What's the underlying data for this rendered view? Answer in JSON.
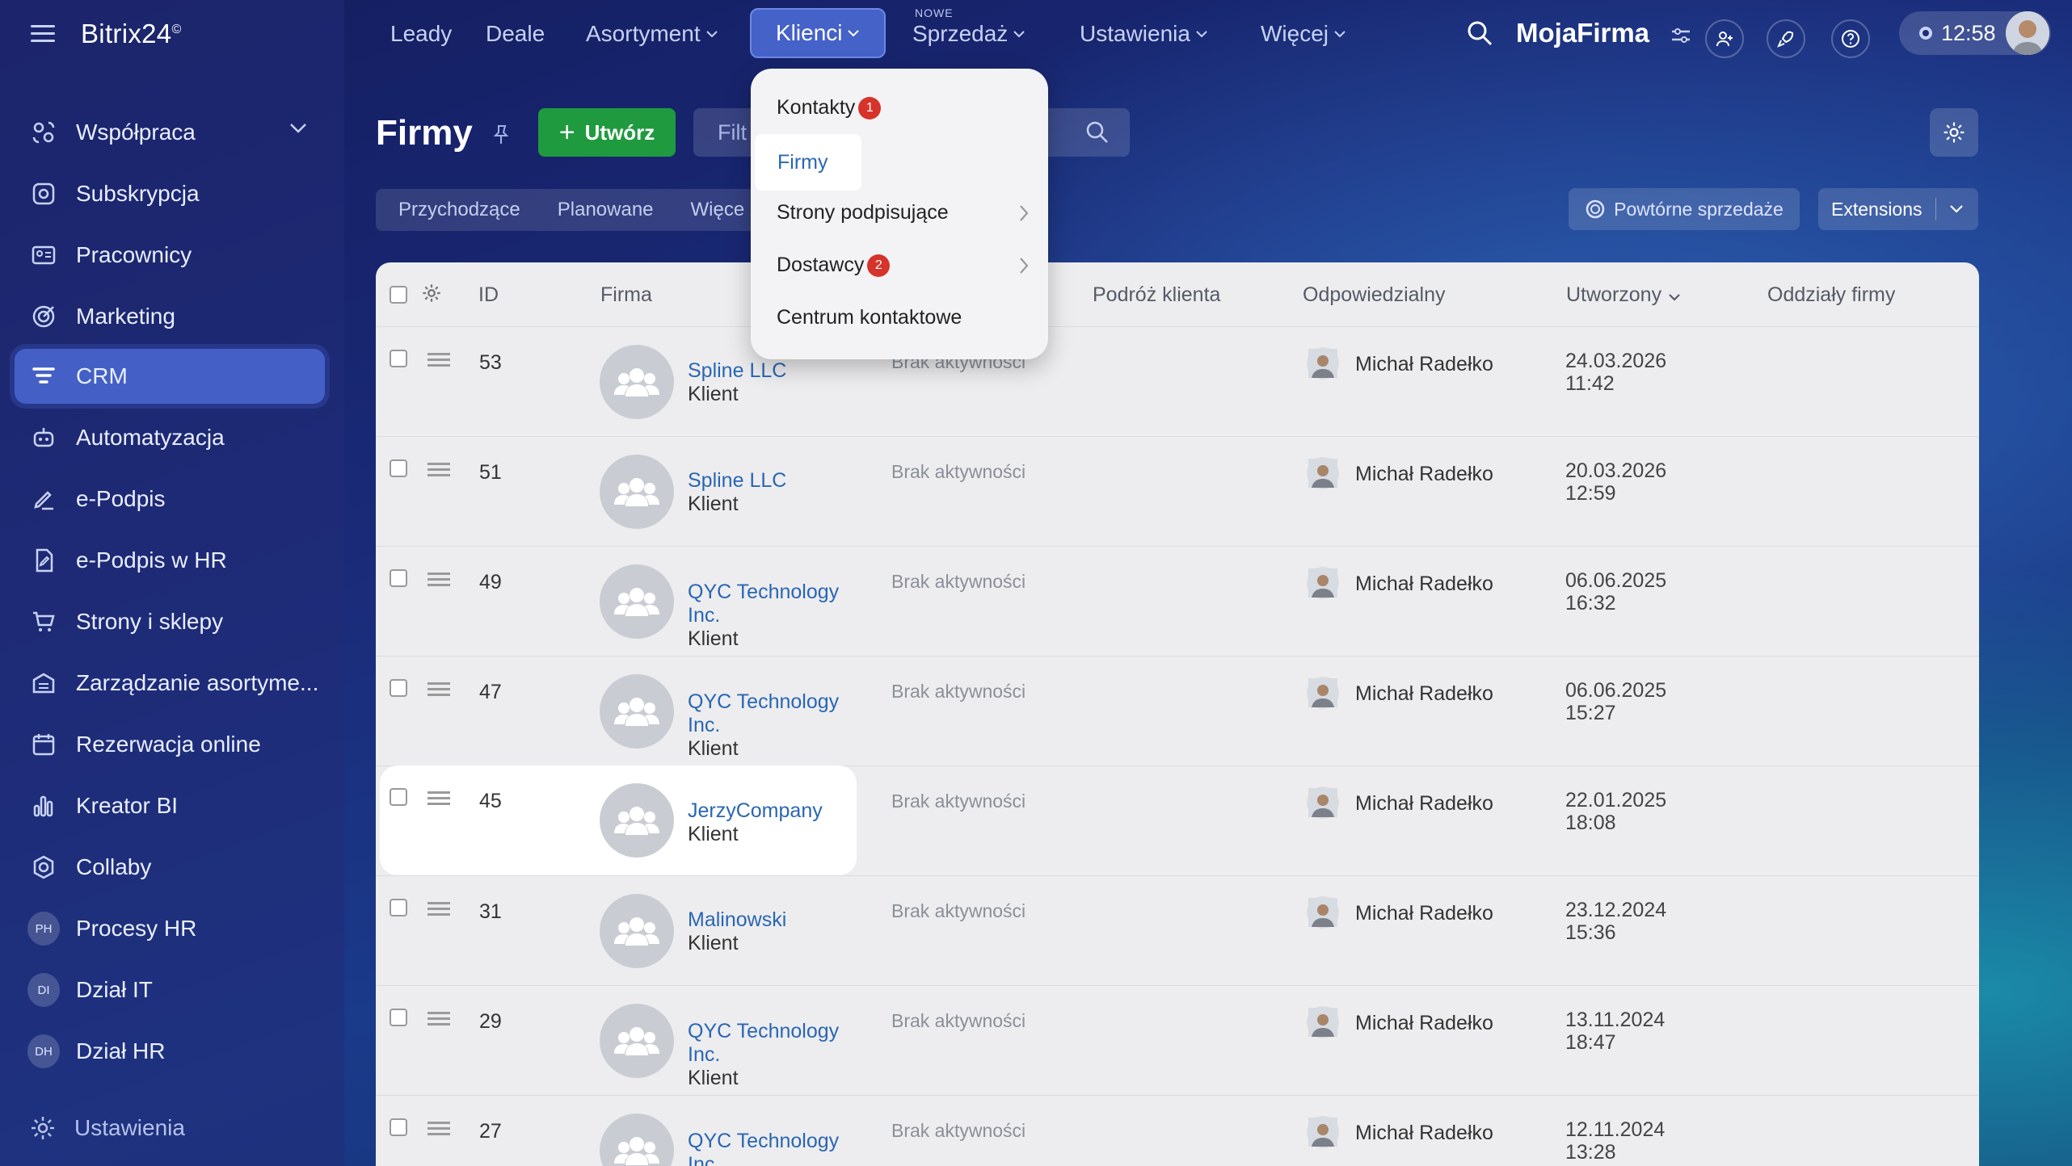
{
  "app": {
    "brand": "Bitrix24",
    "brand_mark": "©"
  },
  "sidebar": {
    "items": [
      {
        "label": "Współpraca",
        "icon": "collab-icon"
      },
      {
        "label": "Subskrypcja",
        "icon": "subscription-icon"
      },
      {
        "label": "Pracownicy",
        "icon": "employees-icon"
      },
      {
        "label": "Marketing",
        "icon": "marketing-icon"
      },
      {
        "label": "CRM",
        "icon": "crm-icon"
      },
      {
        "label": "Automatyzacja",
        "icon": "robot-icon"
      },
      {
        "label": "e-Podpis",
        "icon": "sign-icon"
      },
      {
        "label": "e-Podpis w HR",
        "icon": "hr-sign-icon"
      },
      {
        "label": "Strony i sklepy",
        "icon": "cart-icon"
      },
      {
        "label": "Zarządzanie asortyme...",
        "icon": "warehouse-icon"
      },
      {
        "label": "Rezerwacja online",
        "icon": "calendar-icon"
      },
      {
        "label": "Kreator BI",
        "icon": "chart-icon"
      },
      {
        "label": "Collaby",
        "icon": "collaby-icon"
      },
      {
        "label": "Procesy HR",
        "avatar": "PH"
      },
      {
        "label": "Dział IT",
        "avatar": "DI"
      },
      {
        "label": "Dział HR",
        "avatar": "DH"
      }
    ],
    "settings_label": "Ustawienia"
  },
  "topnav": {
    "items": [
      "Leady",
      "Deale",
      "Asortyment",
      "Klienci",
      "Sprzedaż",
      "Ustawienia",
      "Więcej"
    ],
    "new_badge": "NOWE",
    "company": "MojaFirma",
    "clock": "12:58"
  },
  "page": {
    "title": "Firmy",
    "create_label": "Utwórz",
    "filter_placeholder": "Filt",
    "tabs": [
      "Przychodzące",
      "Planowane",
      "Więce"
    ],
    "repeat_sales": "Powtórne sprzedaże",
    "extensions": "Extensions"
  },
  "dropdown": {
    "items": [
      {
        "label": "Kontakty",
        "badge": "1"
      },
      {
        "label": "Firmy"
      },
      {
        "label": "Strony podpisujące"
      },
      {
        "label": "Dostawcy",
        "badge": "2"
      },
      {
        "label": "Centrum kontaktowe"
      }
    ]
  },
  "table": {
    "headers": {
      "id": "ID",
      "company": "Firma",
      "journey": "Podróż klienta",
      "responsible": "Odpowiedzialny",
      "created": "Utworzony",
      "branches": "Oddziały firmy"
    },
    "rows": [
      {
        "id": "53",
        "name": "Spline LLC",
        "type": "Klient",
        "activity": "Brak aktywności",
        "responsible": "Michał Radełko",
        "date": "24.03.2026",
        "time": "11:42"
      },
      {
        "id": "51",
        "name": "Spline LLC",
        "type": "Klient",
        "activity": "Brak aktywności",
        "responsible": "Michał Radełko",
        "date": "20.03.2026",
        "time": "12:59"
      },
      {
        "id": "49",
        "name": "QYC Technology Inc.",
        "type": "Klient",
        "activity": "Brak aktywności",
        "responsible": "Michał Radełko",
        "date": "06.06.2025",
        "time": "16:32"
      },
      {
        "id": "47",
        "name": "QYC Technology Inc.",
        "type": "Klient",
        "activity": "Brak aktywności",
        "responsible": "Michał Radełko",
        "date": "06.06.2025",
        "time": "15:27"
      },
      {
        "id": "45",
        "name": "JerzyCompany",
        "type": "Klient",
        "activity": "Brak aktywności",
        "responsible": "Michał Radełko",
        "date": "22.01.2025",
        "time": "18:08"
      },
      {
        "id": "31",
        "name": "Malinowski",
        "type": "Klient",
        "activity": "Brak aktywności",
        "responsible": "Michał Radełko",
        "date": "23.12.2024",
        "time": "15:36"
      },
      {
        "id": "29",
        "name": "QYC Technology Inc.",
        "type": "Klient",
        "activity": "Brak aktywności",
        "responsible": "Michał Radełko",
        "date": "13.11.2024",
        "time": "18:47"
      },
      {
        "id": "27",
        "name": "QYC Technology Inc.",
        "type": "",
        "activity": "Brak aktywności",
        "responsible": "Michał Radełko",
        "date": "12.11.2024",
        "time": "13:28"
      }
    ]
  }
}
